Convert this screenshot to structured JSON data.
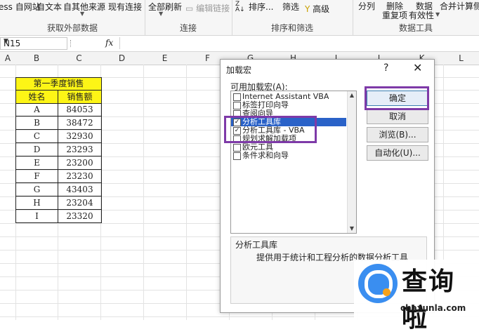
{
  "ribbon": {
    "groups": [
      {
        "label": "获取外部数据",
        "buttons": [
          "ess 自网站",
          "自文本",
          "自其他来源",
          "现有连接"
        ]
      },
      {
        "label": "连接",
        "buttons": [
          "全部刷新",
          "编辑链接"
        ]
      },
      {
        "label": "排序和筛选",
        "buttons": [
          "排序...",
          "筛选",
          "高级"
        ]
      },
      {
        "label": "数据工具",
        "buttons": [
          "分列",
          "删除",
          "重复项",
          "数据",
          "有效性",
          "合并计算",
          "侧"
        ]
      }
    ],
    "zsort_icon": "az-sort-icon"
  },
  "formula_bar": {
    "name_box": "N15",
    "fx_label": "fx",
    "formula": ""
  },
  "columns": [
    "A",
    "B",
    "C",
    "D",
    "E",
    "F",
    "G",
    "H",
    "I",
    "J",
    "K",
    "L"
  ],
  "sheet": {
    "title": "第一季度销售",
    "headers": [
      "姓名",
      "销售额"
    ],
    "rows": [
      {
        "name": "A",
        "sales": "84053"
      },
      {
        "name": "B",
        "sales": "38472"
      },
      {
        "name": "C",
        "sales": "32930"
      },
      {
        "name": "D",
        "sales": "23293"
      },
      {
        "name": "E",
        "sales": "23200"
      },
      {
        "name": "F",
        "sales": "23230"
      },
      {
        "name": "G",
        "sales": "43403"
      },
      {
        "name": "H",
        "sales": "23204"
      },
      {
        "name": "I",
        "sales": "23320"
      }
    ]
  },
  "dialog": {
    "title": "加载宏",
    "help": "?",
    "close": "✕",
    "list_label": "可用加载宏(A):",
    "items": [
      {
        "label": "Internet Assistant VBA",
        "checked": false
      },
      {
        "label": "标签打印向导",
        "checked": false
      },
      {
        "label": "查阅向导",
        "checked": false
      },
      {
        "label": "分析工具库",
        "checked": true
      },
      {
        "label": "分析工具库 - VBA",
        "checked": true
      },
      {
        "label": "规划求解加载项",
        "checked": false
      },
      {
        "label": "欧元工具",
        "checked": false
      },
      {
        "label": "条件求和向导",
        "checked": false
      }
    ],
    "ok": "确定",
    "cancel": "取消",
    "browse": "浏览(B)...",
    "automation": "自动化(U)...",
    "desc_name": "分析工具库",
    "desc_text": "提供用于统计和工程分析的数据分析工具"
  },
  "watermark": {
    "cn": "查询啦",
    "en": "chaxunla.com"
  },
  "colors": {
    "yellow": "#fdf516",
    "highlight": "#7e3aa8",
    "selected": "#2a62c8"
  }
}
